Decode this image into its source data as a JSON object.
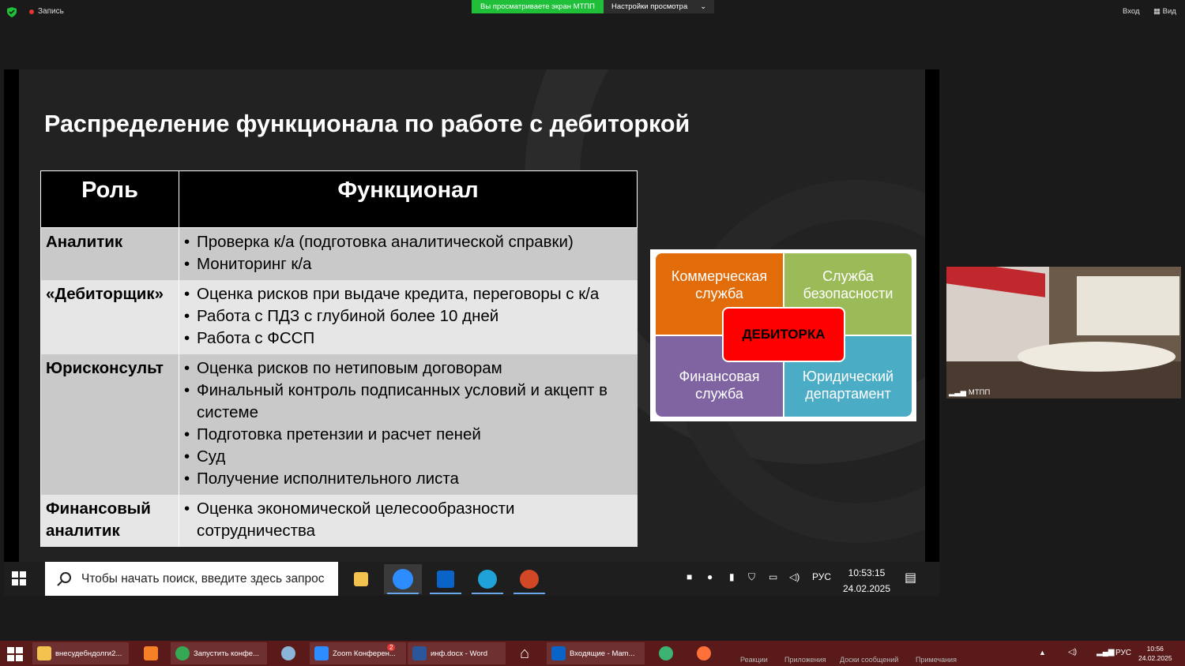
{
  "zoom_top": {
    "recording": "Запись",
    "share_banner": "Вы просматриваете экран МТПП",
    "view_settings": "Настройки просмотра",
    "enter": "Вход",
    "view": "Вид"
  },
  "slide": {
    "title": "Распределение функционала по работе с дебиторкой",
    "table": {
      "headers": [
        "Роль",
        "Функционал"
      ],
      "rows": [
        {
          "role": "Аналитик",
          "items": [
            "Проверка к/а (подготовка аналитической справки)",
            "Мониторинг к/а"
          ]
        },
        {
          "role": "«Дебиторщик»",
          "items": [
            "Оценка рисков при выдаче кредита, переговоры с к/а",
            "Работа с ПДЗ с глубиной более 10 дней",
            "Работа с ФССП"
          ]
        },
        {
          "role": "Юрисконсульт",
          "items": [
            "Оценка рисков по нетиповым договорам",
            "Финальный контроль подписанных условий и акцепт в системе",
            "Подготовка претензии и расчет пеней",
            "Суд",
            "Получение исполнительного листа"
          ]
        },
        {
          "role": "Финансовый аналитик",
          "items": [
            "Оценка экономической целесообразности сотрудничества"
          ]
        }
      ]
    },
    "diagram": {
      "commercial": "Коммерческая служба",
      "security": "Служба безопасности",
      "financial": "Финансовая служба",
      "legal": "Юридический департамент",
      "center": "ДЕБИТОРКА",
      "colors": {
        "commercial": "#e36c0a",
        "security": "#9bbb59",
        "financial": "#8064a2",
        "legal": "#4bacc6",
        "center": "#ff0000"
      }
    }
  },
  "remote_taskbar": {
    "search_placeholder": "Чтобы начать поиск, введите здесь запрос",
    "apps": [
      "file-explorer",
      "zoom",
      "outlook",
      "edge",
      "powerpoint"
    ],
    "lang": "РУС",
    "time": "10:53:15",
    "date": "24.02.2025"
  },
  "video": {
    "participant": "МТПП"
  },
  "local_taskbar": {
    "windows": [
      {
        "label": "внесудебндолги2...",
        "icon": "folder-icon"
      },
      {
        "label": "Запустить конфе...",
        "icon": "chrome-icon"
      },
      {
        "label": "Zoom Конферен...",
        "icon": "zoom-icon"
      },
      {
        "label": "инф.docx - Word",
        "icon": "word-icon"
      },
      {
        "label": "Входящие - Mam...",
        "icon": "outlook-icon"
      }
    ],
    "controls": [
      "Реакции",
      "Приложения",
      "Доски сообщений",
      "Примечания"
    ],
    "badge": "2",
    "lang": "РУС",
    "time": "10:56",
    "date": "24.02.2025"
  }
}
